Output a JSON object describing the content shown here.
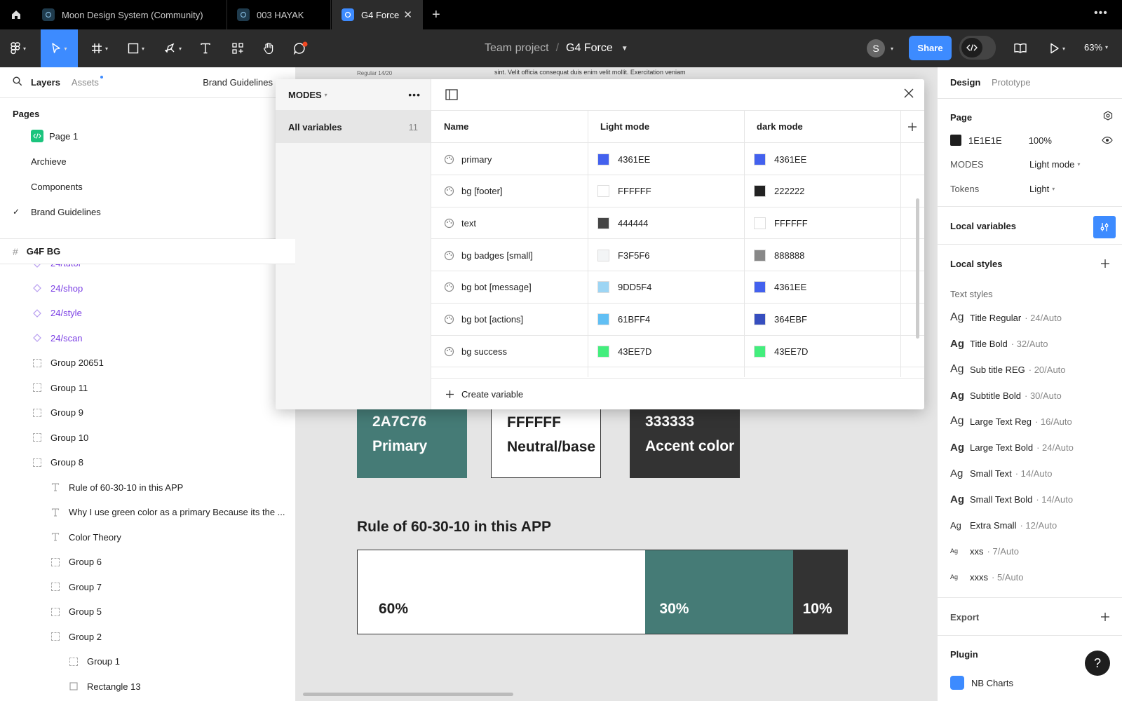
{
  "tabs": [
    {
      "label": "Moon Design System (Community)",
      "active": false
    },
    {
      "label": "003 HAYAK",
      "active": false
    },
    {
      "label": "G4 Force",
      "active": true
    }
  ],
  "toolbar": {
    "team": "Team project",
    "separator": "/",
    "file": "G4 Force",
    "avatar_letter": "S",
    "share_label": "Share",
    "zoom": "63%"
  },
  "left": {
    "tab_layers": "Layers",
    "tab_assets": "Assets",
    "current_page_label": "Brand Guidelines",
    "pages_title": "Pages",
    "pages": [
      {
        "label": "Page 1"
      },
      {
        "label": "Archieve"
      },
      {
        "label": "Components"
      },
      {
        "label": "Brand Guidelines"
      }
    ],
    "frame": "G4F BG",
    "layers": [
      {
        "label": "24/tutor",
        "type": "component",
        "indent": 0
      },
      {
        "label": "24/shop",
        "type": "component",
        "indent": 0
      },
      {
        "label": "24/style",
        "type": "component",
        "indent": 0
      },
      {
        "label": "24/scan",
        "type": "component",
        "indent": 0
      },
      {
        "label": "Group 20651",
        "type": "group",
        "indent": 0
      },
      {
        "label": "Group 11",
        "type": "group",
        "indent": 0
      },
      {
        "label": "Group 9",
        "type": "group",
        "indent": 0
      },
      {
        "label": "Group 10",
        "type": "group",
        "indent": 0
      },
      {
        "label": "Group 8",
        "type": "group",
        "indent": 0
      },
      {
        "label": "Rule of 60-30-10 in this APP",
        "type": "text",
        "indent": 1
      },
      {
        "label": "Why I use green color as a primary Because its the ...",
        "type": "text",
        "indent": 1
      },
      {
        "label": "Color Theory",
        "type": "text",
        "indent": 1
      },
      {
        "label": "Group 6",
        "type": "group",
        "indent": 1
      },
      {
        "label": "Group 7",
        "type": "group",
        "indent": 1
      },
      {
        "label": "Group 5",
        "type": "group",
        "indent": 1
      },
      {
        "label": "Group 2",
        "type": "group",
        "indent": 1
      },
      {
        "label": "Group 1",
        "type": "group",
        "indent": 2
      },
      {
        "label": "Rectangle 13",
        "type": "rect",
        "indent": 2
      }
    ]
  },
  "canvas": {
    "top_caption": "Regular 14/20",
    "top_text": "sint. Velit officia consequat duis enim velit mollit. Exercitation veniam",
    "swatches": [
      {
        "hex": "2A7C76",
        "name": "Primary",
        "bg": "#457b76",
        "fg": "#ffffff"
      },
      {
        "hex": "FFFFFF",
        "name": "Neutral/base",
        "bg": "#ffffff",
        "fg": "#1e1e1e"
      },
      {
        "hex": "333333",
        "name": "Accent color",
        "bg": "#333333",
        "fg": "#ffffff"
      }
    ],
    "rule_title": "Rule of 60-30-10 in this APP",
    "rule": [
      {
        "label": "60%",
        "value": 60,
        "color": "#ffffff",
        "fg": "#1e1e1e"
      },
      {
        "label": "30%",
        "value": 30,
        "color": "#457b76",
        "fg": "#ffffff"
      },
      {
        "label": "10%",
        "value": 10,
        "color": "#333333",
        "fg": "#ffffff"
      }
    ]
  },
  "modal": {
    "collection": "MODES",
    "all_variables": "All variables",
    "count": "11",
    "col_name": "Name",
    "col_light": "Light mode",
    "col_dark": "dark mode",
    "variables": [
      {
        "name": "primary",
        "light": "4361EE",
        "light_color": "#4361EE",
        "dark": "4361EE",
        "dark_color": "#4361EE"
      },
      {
        "name": "bg [footer]",
        "light": "FFFFFF",
        "light_color": "#FFFFFF",
        "dark": "222222",
        "dark_color": "#222222"
      },
      {
        "name": "text",
        "light": "444444",
        "light_color": "#444444",
        "dark": "FFFFFF",
        "dark_color": "#FFFFFF"
      },
      {
        "name": "bg badges [small]",
        "light": "F3F5F6",
        "light_color": "#F3F5F6",
        "dark": "888888",
        "dark_color": "#888888"
      },
      {
        "name": "bg bot [message]",
        "light": "9DD5F4",
        "light_color": "#9DD5F4",
        "dark": "4361EE",
        "dark_color": "#4361EE"
      },
      {
        "name": "bg bot [actions]",
        "light": "61BFF4",
        "light_color": "#61BFF4",
        "dark": "364EBF",
        "dark_color": "#364EBF"
      },
      {
        "name": "bg success",
        "light": "43EE7D",
        "light_color": "#43EE7D",
        "dark": "43EE7D",
        "dark_color": "#43EE7D"
      }
    ],
    "create_label": "Create variable"
  },
  "right": {
    "tab_design": "Design",
    "tab_prototype": "Prototype",
    "page_title": "Page",
    "page_color": "1E1E1E",
    "page_opacity": "100%",
    "modes_label": "MODES",
    "modes_value": "Light mode",
    "tokens_label": "Tokens",
    "tokens_value": "Light",
    "local_variables": "Local variables",
    "local_styles": "Local styles",
    "text_styles": "Text styles",
    "styles": [
      {
        "ag": "Ag",
        "name": "Title Regular",
        "meta": "· 24/Auto",
        "bold": false
      },
      {
        "ag": "Ag",
        "name": "Title Bold",
        "meta": "· 32/Auto",
        "bold": true
      },
      {
        "ag": "Ag",
        "name": "Sub title REG",
        "meta": "· 20/Auto",
        "bold": false
      },
      {
        "ag": "Ag",
        "name": "Subtitle Bold",
        "meta": "· 30/Auto",
        "bold": true
      },
      {
        "ag": "Ag",
        "name": "Large Text Reg",
        "meta": "· 16/Auto",
        "bold": false
      },
      {
        "ag": "Ag",
        "name": "Large Text Bold",
        "meta": "· 24/Auto",
        "bold": true
      },
      {
        "ag": "Ag",
        "name": "Small Text",
        "meta": "· 14/Auto",
        "bold": false
      },
      {
        "ag": "Ag",
        "name": "Small Text Bold",
        "meta": "· 14/Auto",
        "bold": true
      },
      {
        "ag": "Ag",
        "name": "Extra Small",
        "meta": "· 12/Auto",
        "bold": false
      },
      {
        "ag": "Ag",
        "name": "xxs",
        "meta": "· 7/Auto",
        "bold": false
      },
      {
        "ag": "Ag",
        "name": "xxxs",
        "meta": "· 5/Auto",
        "bold": false
      }
    ],
    "export": "Export",
    "plugin": "Plugin",
    "plugin_item": "NB Charts"
  }
}
